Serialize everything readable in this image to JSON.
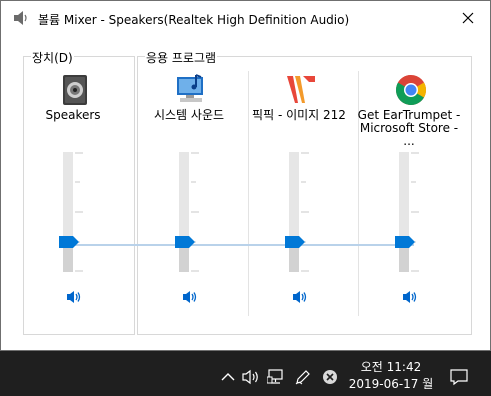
{
  "window": {
    "title": "볼륨 Mixer - Speakers(Realtek High Definition Audio)"
  },
  "groups": {
    "device_label": "장치(D)",
    "apps_label": "응용 프로그램"
  },
  "channels": [
    {
      "label": "Speakers",
      "icon": "speaker-device-icon",
      "level": 0.25
    },
    {
      "label": "시스템 사운드",
      "icon": "system-sounds-icon",
      "level": 0.25
    },
    {
      "label": "픽픽 - 이미지 212",
      "icon": "picpick-icon",
      "level": 0.25
    },
    {
      "label": "Get EarTrumpet -\nMicrosoft Store - ...",
      "icon": "chrome-icon",
      "level": 0.25
    }
  ],
  "colors": {
    "accent": "#0078d7",
    "slider_track": "#e6e6e6",
    "taskbar": "#1f1f1f"
  },
  "taskbar": {
    "time": "오전 11:42",
    "date": "2019-06-17 월"
  }
}
